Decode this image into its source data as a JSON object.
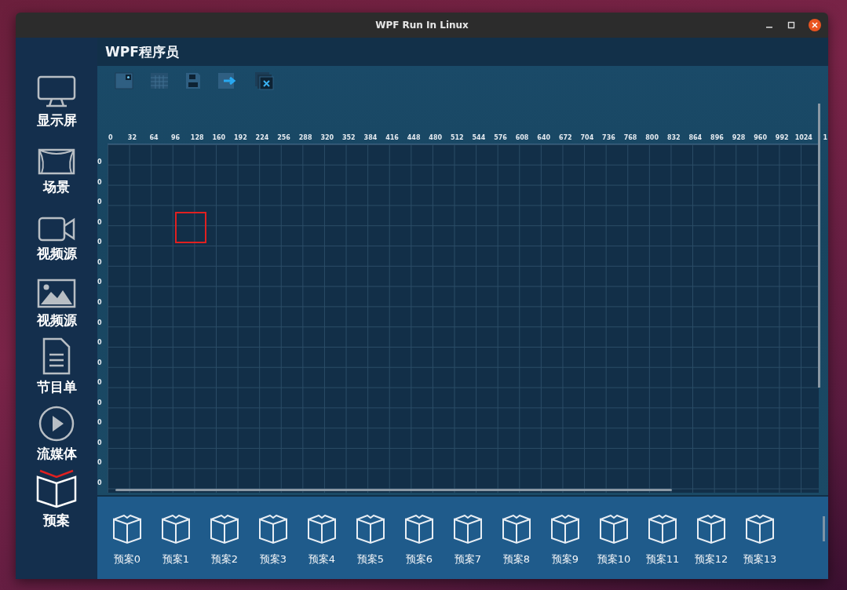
{
  "window": {
    "title": "WPF Run In Linux"
  },
  "sidebar": {
    "items": [
      {
        "label": "显示屏",
        "kind": "monitor",
        "selected": false
      },
      {
        "label": "场景",
        "kind": "scene",
        "selected": false
      },
      {
        "label": "视频源",
        "kind": "camera",
        "selected": false
      },
      {
        "label": "视频源",
        "kind": "image",
        "selected": false
      },
      {
        "label": "节目单",
        "kind": "document",
        "selected": false
      },
      {
        "label": "流媒体",
        "kind": "play",
        "selected": false
      },
      {
        "label": "预案",
        "kind": "book",
        "selected": true
      }
    ]
  },
  "header": {
    "title": "WPF程序员"
  },
  "toolbar": {
    "buttons": [
      {
        "kind": "new"
      },
      {
        "kind": "grid"
      },
      {
        "kind": "save"
      },
      {
        "kind": "export"
      },
      {
        "kind": "close-all"
      }
    ]
  },
  "ruler": {
    "x_labels": [
      "0",
      "32",
      "64",
      "96",
      "128",
      "160",
      "192",
      "224",
      "256",
      "288",
      "320",
      "352",
      "384",
      "416",
      "448",
      "480",
      "512",
      "544",
      "576",
      "608",
      "640",
      "672",
      "704",
      "736",
      "768",
      "800",
      "832",
      "864",
      "896",
      "928",
      "960",
      "992",
      "1024",
      "1"
    ],
    "y_labels": [
      "0",
      "0",
      "0",
      "0",
      "0",
      "0",
      "0",
      "0",
      "0",
      "0",
      "0",
      "0",
      "0",
      "0",
      "0",
      "0",
      "0"
    ]
  },
  "plans": [
    "预案0",
    "预案1",
    "预案2",
    "预案3",
    "预案4",
    "预案5",
    "预案6",
    "预案7",
    "预案8",
    "预案9",
    "预案10",
    "预案11",
    "预案12",
    "预案13"
  ]
}
